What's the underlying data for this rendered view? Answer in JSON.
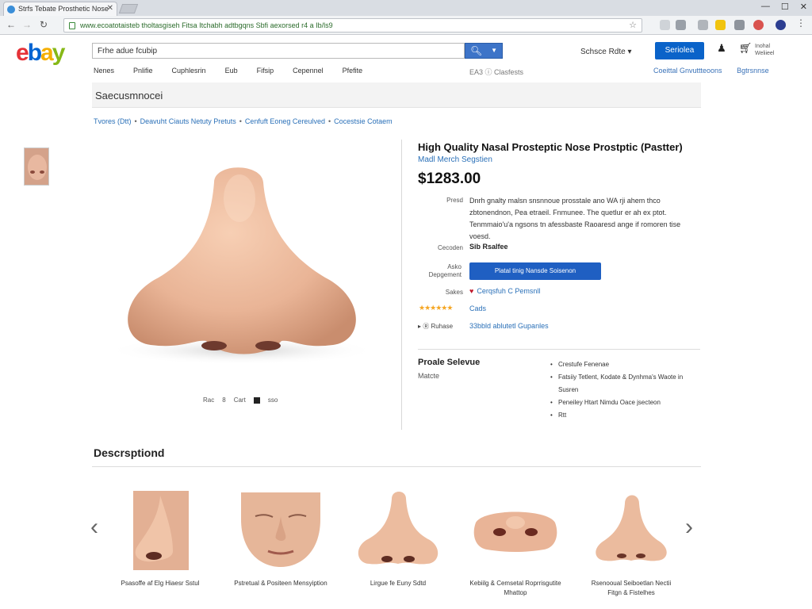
{
  "browser": {
    "tab_title": "Strfs Tebate Prosthetic Nose",
    "address": "www.ecoatotaisteb tholtasgiseh  Fitsa Itchabh adtbgqns Sbfi aexorsed r4 a Ib/ls9"
  },
  "header": {
    "logo_letters": [
      "e",
      "b",
      "a",
      "y"
    ],
    "search_value": "Frhe adue fcubip",
    "category_dropdown": "Schsce Rdte",
    "signin_label": "Seriolea",
    "cart_label": "Inohal Weliieel",
    "cat_nav": [
      "Nenes",
      "Pnlifie",
      "Cuphlesrin",
      "Eub",
      "Fifsip",
      "Cepennel",
      "Pfefite"
    ],
    "subnav_mid": "EA3 ⓘ Clasfests",
    "subnav_right": [
      "Coeittal Gnvuttteoons",
      "Bgtrsnnse"
    ]
  },
  "page": {
    "bar_title": "Saecusmnocei",
    "breadcrumb": [
      "Tvores (Dtt)",
      "Deavuht Ciauts  Netuty Pretuts",
      "Cenfuft Eoneg Cereulved",
      "Cocestsie Cotaem"
    ]
  },
  "product": {
    "title": "High Quality Nasal Prosteptic Nose Prostptic (Pastter)",
    "subtitle": "Madl Merch Segstien",
    "price": "$1283.00",
    "desc_label": "Presd",
    "description": "Dnrh gnalty malsn snsnnoue prosstale ano WA rji ahem thco zbtonendnon, Pea etraeil. Fnmunee. The quetlur er ah ex ptot. Tenmmaio'u'a ngsons tn afessbaste Raoaresd ange if romoren tise voesd.",
    "condition_label": "Cecoden",
    "condition_value": "Sib Rsalfee",
    "buy_label": "Asko Depgement",
    "buy_button": "Platal tinig Nansde Soisenon",
    "seller_label": "Sakes",
    "seller_name": "Cerqsfuh C Pemsnll",
    "stars": "★★★★★★",
    "reviews": "Cads",
    "shipping_label": "▸ Ⓡ Ruhase",
    "shipping_link": "33bbld ablutetl Gupanles",
    "spec_title": "Proale Selevue",
    "spec_sub": "Matcte",
    "specs": [
      "Crestufe Fenenae",
      "Fatsiiy Tetlent, Kodate & Dynhma's Waote in Susren",
      "Peneiley Htart Nimdu Oace jsecteon",
      "Rtt"
    ]
  },
  "image_controls": [
    "Rac",
    "8",
    "Cart",
    "sso"
  ],
  "description_section": {
    "heading": "Descrsptiond",
    "gallery": [
      {
        "caption": "Psasoffe af Elg Hiaesr Sstul"
      },
      {
        "caption": "Pstretual & Positeen Mensyiption"
      },
      {
        "caption": "Lirgue fe Euny Sdtd"
      },
      {
        "caption": "Kebiilg & Cemsetal Roprrisgutite Mhattop"
      },
      {
        "caption": "Rsenooual Seiboetlan Nectii Fitgn & Fistelhes"
      }
    ]
  },
  "colors": {
    "ebay_red": "#e53238",
    "ebay_blue": "#0064d2",
    "ebay_yellow": "#f5af02",
    "ebay_green": "#86b817",
    "link_blue": "#2a70b8",
    "button_blue": "#1f5fc2",
    "skin": "#e9b496"
  }
}
